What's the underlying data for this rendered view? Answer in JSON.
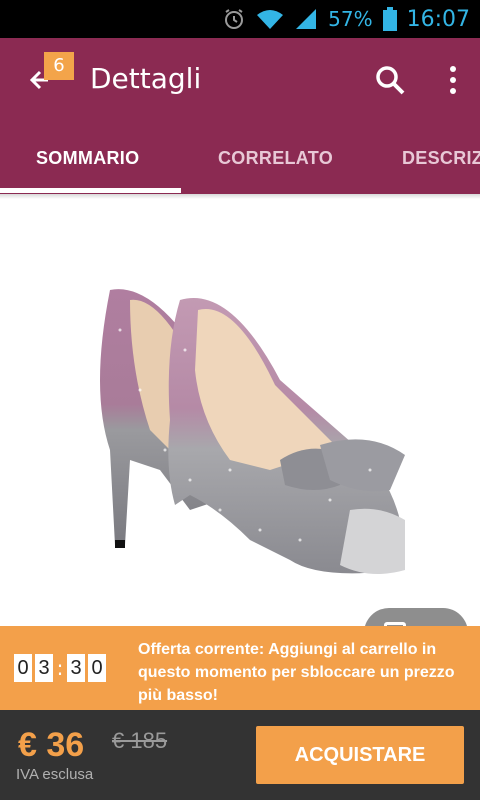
{
  "status_bar": {
    "battery_percent": "57%",
    "time": "16:07",
    "icons": [
      "alarm-icon",
      "wifi-icon",
      "signal-icon",
      "battery-icon"
    ]
  },
  "app_bar": {
    "title": "Dettagli",
    "cart_count": "6",
    "background_color": "#8b2a52"
  },
  "tabs": [
    {
      "label": "SOMMARIO",
      "active": true
    },
    {
      "label": "CORRELATO",
      "active": false
    },
    {
      "label": "DESCRIZ",
      "active": false
    }
  ],
  "offer": {
    "timer": [
      "0",
      "3",
      ":",
      "3",
      "0"
    ],
    "text": "Offerta corrente: Aggiungi al carrello in questo momento per sbloccare un prezzo più basso!",
    "accent_color": "#f3a04a"
  },
  "purchase": {
    "price": "€ 36",
    "old_price": "€ 185",
    "vat_note": "IVA esclusa",
    "buy_label": "ACQUISTARE"
  }
}
